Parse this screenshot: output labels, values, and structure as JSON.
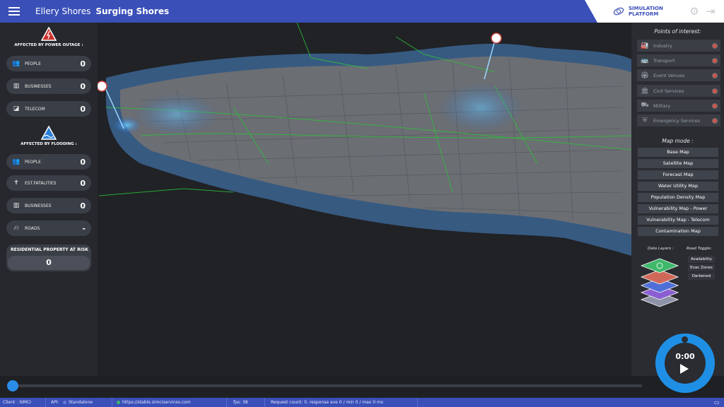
{
  "header": {
    "app_title": "Ellery Shores",
    "scenario_title": "Surging Shores",
    "platform_label": "SIMULATION PLATFORM",
    "accent": "#3a4fb8"
  },
  "left_panel": {
    "power": {
      "title": "AFFECTED BY POWER OUTAGE :",
      "items": [
        {
          "icon": "people-icon",
          "label": "PEOPLE",
          "value": "0"
        },
        {
          "icon": "businesses-icon",
          "label": "BUSINESSES",
          "value": "0"
        },
        {
          "icon": "telecom-icon",
          "label": "TELECOM",
          "value": "0"
        }
      ]
    },
    "flooding": {
      "title": "AFFECTED BY FLOODING :",
      "items": [
        {
          "icon": "people-icon",
          "label": "PEOPLE",
          "value": "0"
        },
        {
          "icon": "fatalities-icon",
          "label": "EST.FATALITIES",
          "value": "0"
        },
        {
          "icon": "businesses-icon",
          "label": "BUSINESSES",
          "value": "0"
        },
        {
          "icon": "roads-icon",
          "label": "ROADS",
          "value": "-"
        }
      ]
    },
    "residential": {
      "label": "RESIDENTIAL PROPERTY AT RISK",
      "value": "0"
    }
  },
  "right_panel": {
    "poi_title": "Points of interest:",
    "poi": [
      {
        "icon": "industry-icon",
        "label": "Industry"
      },
      {
        "icon": "transport-icon",
        "label": "Transport"
      },
      {
        "icon": "event-venues-icon",
        "label": "Event Venues"
      },
      {
        "icon": "civil-services-icon",
        "label": "Civil Services"
      },
      {
        "icon": "military-icon",
        "label": "Military"
      },
      {
        "icon": "emergency-services-icon",
        "label": "Emergency Services"
      }
    ],
    "map_mode_title": "Map mode :",
    "map_modes": [
      "Base Map",
      "Satellite Map",
      "Forecast Map",
      "Water Utility Map",
      "Population Density Map",
      "Vulnerability Map - Power",
      "Vulnerability Map - Telecom",
      "Contamination Map"
    ],
    "data_layers_label": "Data Layers :",
    "road_toggle_label": "Road Toggle:",
    "road_toggles": [
      "Availability",
      "Evac Zones",
      "Darkened"
    ]
  },
  "player": {
    "time": "0:00",
    "progress": 0
  },
  "statusbar": {
    "client": "Client : SIMCI",
    "api_label": "API:",
    "api_value": "Standalone",
    "url": "https://stable.simciservices.com",
    "fps": "fps: 38",
    "request": "Request count: 0, response ave 0 / min 0 / max 0 ms"
  }
}
